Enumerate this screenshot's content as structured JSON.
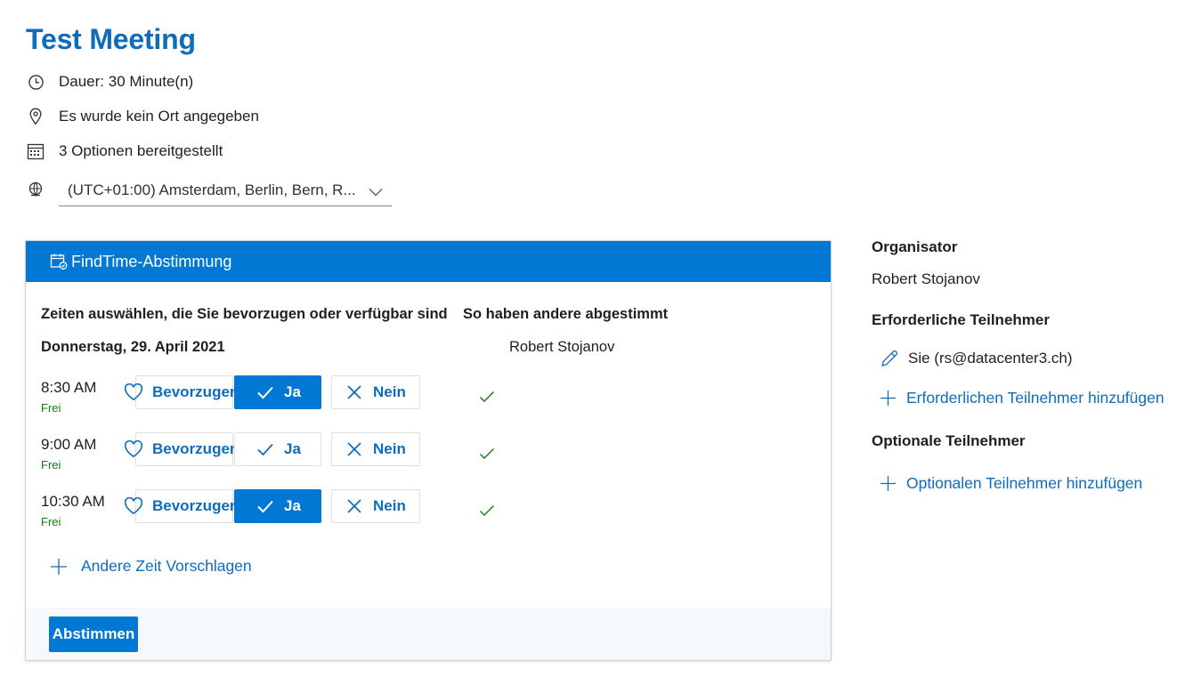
{
  "meeting": {
    "title": "Test Meeting",
    "duration": "Dauer: 30 Minute(n)",
    "location": "Es wurde kein Ort angegeben",
    "options": "3 Optionen bereitgestellt",
    "timezone": "(UTC+01:00) Amsterdam, Berlin, Bern, R..."
  },
  "poll": {
    "header": "FindTime-Abstimmung",
    "col_select": "Zeiten auswählen, die Sie bevorzugen oder verfügbar sind",
    "col_others": "So haben andere abgestimmt",
    "date": "Donnerstag, 29. April 2021",
    "voter": "Robert Stojanov",
    "prefer_label": "Bevorzugen",
    "yes_label": "Ja",
    "no_label": "Nein",
    "slots": [
      {
        "time": "8:30 AM",
        "status": "Frei",
        "yes_selected": true
      },
      {
        "time": "9:00 AM",
        "status": "Frei",
        "yes_selected": false
      },
      {
        "time": "10:30 AM",
        "status": "Frei",
        "yes_selected": true
      }
    ],
    "suggest_label": "Andere Zeit Vorschlagen",
    "submit_label": "Abstimmen"
  },
  "sidebar": {
    "organizer_heading": "Organisator",
    "organizer_name": "Robert Stojanov",
    "required_heading": "Erforderliche Teilnehmer",
    "required_self": "Sie (rs@datacenter3.ch)",
    "add_required": "Erforderlichen Teilnehmer hinzufügen",
    "optional_heading": "Optionale Teilnehmer",
    "add_optional": "Optionalen Teilnehmer hinzufügen"
  },
  "colors": {
    "accent": "#0078d4",
    "link": "#0f6cbd",
    "free": "#107c10"
  }
}
